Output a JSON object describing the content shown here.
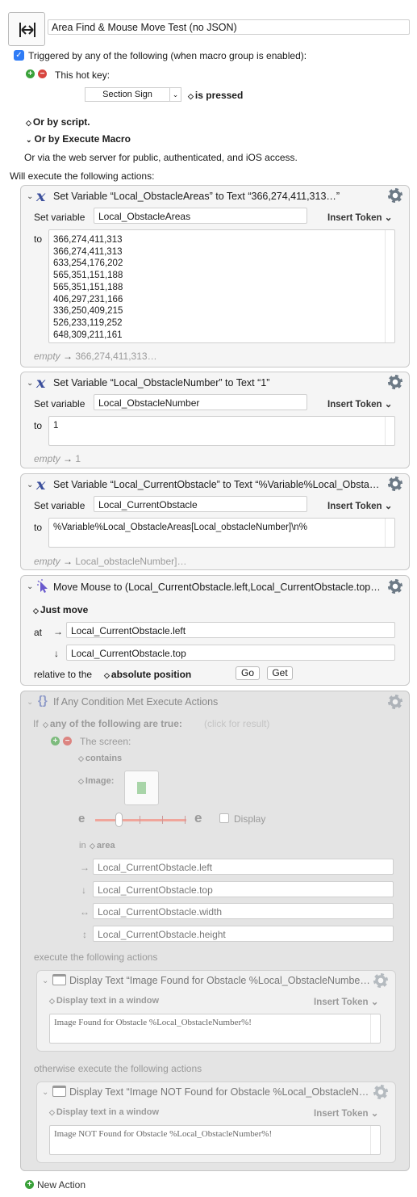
{
  "macro": {
    "name": "Area Find & Mouse Move Test (no JSON)",
    "trigger_checkbox_label": "Triggered by any of the following (when macro group is enabled):",
    "hotkey_label": "This hot key:",
    "hotkey_value": "Section Sign",
    "hotkey_condition": "is pressed",
    "or_by_script": "Or by script.",
    "or_by_execute": "Or by Execute Macro",
    "web_server_text": "Or via the web server for public, authenticated, and iOS access.",
    "will_execute": "Will execute the following actions:"
  },
  "actions": {
    "a1": {
      "title": "Set Variable “Local_ObstacleAreas” to Text “366,274,411,313…”",
      "set_variable_label": "Set variable",
      "variable": "Local_ObstacleAreas",
      "insert_token": "Insert Token",
      "to_label": "to",
      "lines": [
        "366,274,411,313",
        "366,274,411,313",
        "633,254,176,202",
        "565,351,151,188",
        "565,351,151,188",
        "406,297,231,166",
        "336,250,409,215",
        "526,233,119,252",
        "648,309,211,161"
      ],
      "preview_empty": "empty",
      "preview_value": "366,274,411,313…"
    },
    "a2": {
      "title": "Set Variable “Local_ObstacleNumber” to Text “1”",
      "set_variable_label": "Set variable",
      "variable": "Local_ObstacleNumber",
      "insert_token": "Insert Token",
      "to_label": "to",
      "value": "1",
      "preview_empty": "empty",
      "preview_value": "1"
    },
    "a3": {
      "title": "Set Variable “Local_CurrentObstacle” to Text “%Variable%Local_Obsta…",
      "set_variable_label": "Set variable",
      "variable": "Local_CurrentObstacle",
      "insert_token": "Insert Token",
      "to_label": "to",
      "value": "%Variable%Local_ObstacleAreas[Local_obstacleNumber]\\n%",
      "preview_empty": "empty",
      "preview_value": "Local_obstacleNumber]…"
    },
    "a4": {
      "title": "Move Mouse to (Local_CurrentObstacle.left,Local_CurrentObstacle.top…",
      "mode": "Just move",
      "at_label": "at",
      "x_value": "Local_CurrentObstacle.left",
      "y_value": "Local_CurrentObstacle.top",
      "relative_label": "relative to the",
      "relative_value": "absolute position",
      "go_label": "Go",
      "get_label": "Get"
    },
    "a5": {
      "title": "If Any Condition Met Execute Actions",
      "if_label": "If",
      "any_label": "any of the following are true:",
      "click_result": "(click for result)",
      "screen_label": "The screen:",
      "contains_label": "contains",
      "image_label": "Image:",
      "display_label": "Display",
      "area_in": "in",
      "area_label": "area",
      "left": "Local_CurrentObstacle.left",
      "top": "Local_CurrentObstacle.top",
      "width": "Local_CurrentObstacle.width",
      "height": "Local_CurrentObstacle.height",
      "execute_label": "execute the following actions",
      "otherwise_label": "otherwise execute the following actions",
      "found": {
        "title": "Display Text “Image Found for Obstacle %Local_ObstacleNumbe…",
        "mode": "Display text in a window",
        "insert_token": "Insert Token",
        "text": "Image Found for Obstacle %Local_ObstacleNumber%!"
      },
      "not_found": {
        "title": "Display Text “Image NOT Found for Obstacle %Local_ObstacleN…",
        "mode": "Display text in a window",
        "insert_token": "Insert Token",
        "text": "Image NOT Found for Obstacle %Local_ObstacleNumber%!"
      }
    }
  },
  "footer": {
    "new_action": "New Action"
  }
}
